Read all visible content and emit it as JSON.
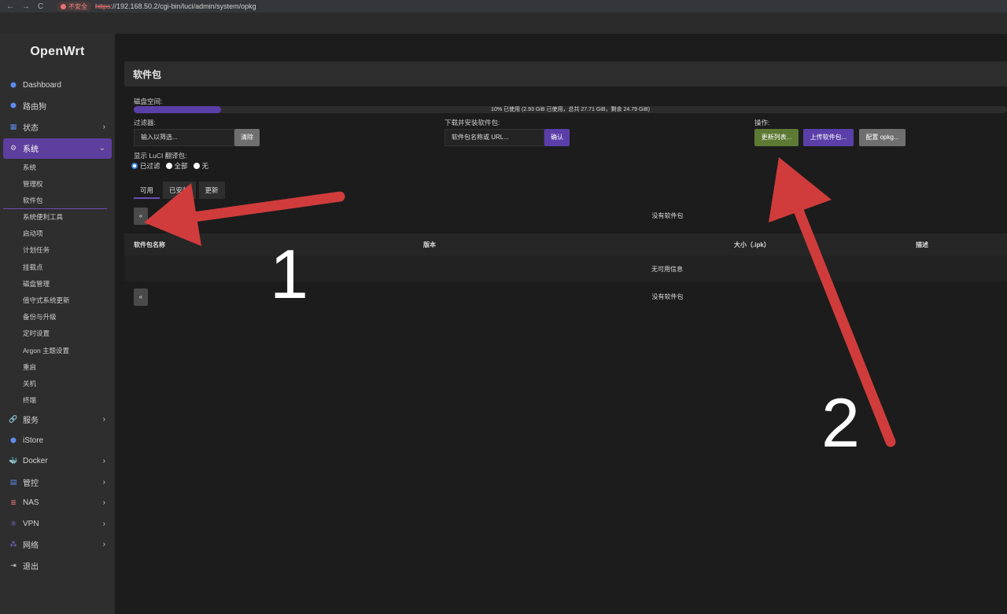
{
  "browser": {
    "nav_back": "←",
    "nav_forward": "→",
    "nav_reload": "C",
    "insecure_label": "不安全",
    "url_scheme": "https",
    "url_rest": "://192.168.50.2/cgi-bin/luci/admin/system/opkg"
  },
  "sidebar": {
    "logo": "OpenWrt",
    "items": [
      {
        "label": "Dashboard",
        "icon": "cube-icon",
        "glyph": "⬢"
      },
      {
        "label": "路由狗",
        "icon": "cube-icon",
        "glyph": "⬢"
      },
      {
        "label": "状态",
        "icon": "grid-icon",
        "glyph": "▦"
      },
      {
        "label": "系统",
        "icon": "gear-icon",
        "glyph": "⚙"
      }
    ],
    "submenu": [
      "系统",
      "管理权",
      "软件包",
      "系统便利工具",
      "启动项",
      "计划任务",
      "挂载点",
      "磁盘管理",
      "值守式系统更新",
      "备份与升级",
      "定时设置",
      "Argon 主题设置",
      "重启",
      "关机",
      "终端"
    ],
    "items_after": [
      {
        "label": "服务",
        "glyph": "🔗"
      },
      {
        "label": "iStore",
        "glyph": "⬢"
      },
      {
        "label": "Docker",
        "glyph": "🐳"
      },
      {
        "label": "管控",
        "glyph": "▤"
      },
      {
        "label": "NAS",
        "glyph": "≣"
      },
      {
        "label": "VPN",
        "glyph": "⚛"
      },
      {
        "label": "网络",
        "glyph": "⁂"
      },
      {
        "label": "退出",
        "glyph": "⇥"
      }
    ],
    "chevron_right": "›",
    "chevron_down": "⌄"
  },
  "page": {
    "title": "软件包",
    "disk_label": "磁盘空间:",
    "disk_used_percent": 10,
    "disk_text": "10% 已使用 (2.93 GiB 已使用，总共 27.71 GiB，剩余 24.79 GiB)",
    "filter_label": "过滤器:",
    "filter_placeholder": "输入以筛选...",
    "clear_button": "清除",
    "download_label": "下载并安装软件包:",
    "download_placeholder": "软件包名称或 URL...",
    "confirm_button": "确认",
    "actions_label": "操作:",
    "update_button": "更新列表...",
    "upload_button": "上传软件包...",
    "config_button": "配置 opkg...",
    "luci_label": "显示 LuCI 翻译包:",
    "radio_filtered": "已过滤",
    "radio_all": "全部",
    "radio_none": "无",
    "tabs": [
      "可用",
      "已安装",
      "更新"
    ],
    "pager_prev": "«",
    "no_packages": "没有软件包",
    "columns": [
      "软件包名称",
      "版本",
      "大小（.ipk）",
      "描述"
    ],
    "no_info": "无可用信息"
  },
  "annotations": {
    "label_1": "1",
    "label_2": "2",
    "arrow_color": "#d03c3c"
  }
}
